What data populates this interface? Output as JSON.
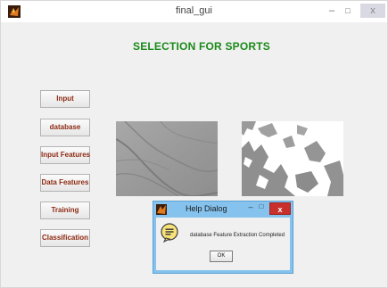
{
  "window": {
    "title": "final_gui",
    "minimize": "–",
    "maximize": "□",
    "close": "x"
  },
  "heading": "SELECTION FOR SPORTS",
  "buttons": {
    "input": "Input",
    "database": "database",
    "input_features": "Input Features",
    "data_features": "Data Features",
    "training": "Training",
    "classification": "Classification"
  },
  "dialog": {
    "title": "Help Dialog",
    "minimize": "–",
    "maximize": "□",
    "close": "x",
    "message": "database Feature Extraction Completed",
    "ok": "OK"
  },
  "colors": {
    "heading": "#1a8a1a",
    "button_text": "#8e2a12",
    "dialog_frame": "#85c3ee",
    "dialog_close": "#c9302c"
  },
  "icons": {
    "app": "matlab-icon",
    "dialog": "matlab-icon",
    "help": "help-speech-icon"
  }
}
